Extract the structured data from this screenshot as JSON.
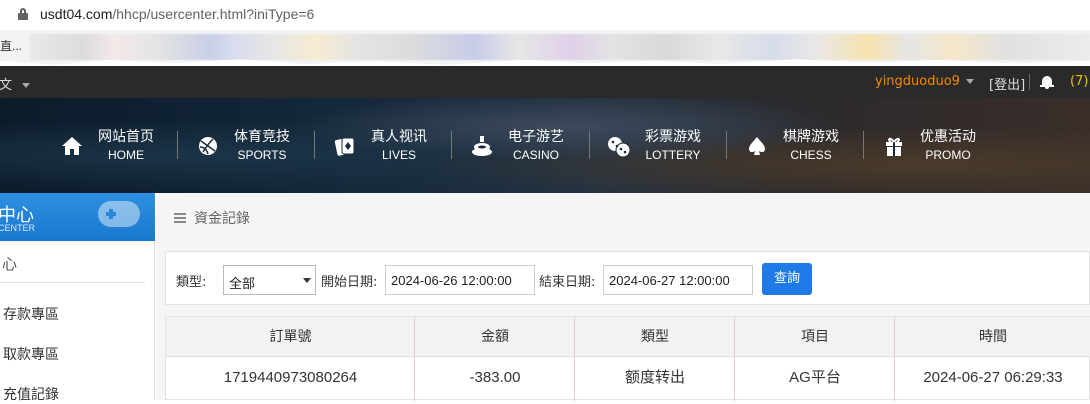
{
  "browser": {
    "url_host": "usdt04.com",
    "url_path": "/hhcp/usercenter.html?iniType=6",
    "bookmark_leading": "直..."
  },
  "topbar": {
    "language": "中文",
    "username": "yingduoduo9",
    "logout": "[登出]",
    "notifications": "(7)"
  },
  "nav": [
    {
      "cn": "网站首页",
      "en": "HOME",
      "icon": "home-icon"
    },
    {
      "cn": "体育竞技",
      "en": "SPORTS",
      "icon": "basketball-icon"
    },
    {
      "cn": "真人视讯",
      "en": "LIVES",
      "icon": "cards-icon"
    },
    {
      "cn": "电子游艺",
      "en": "CASINO",
      "icon": "slot-icon"
    },
    {
      "cn": "彩票游戏",
      "en": "LOTTERY",
      "icon": "dice-icon"
    },
    {
      "cn": "棋牌游戏",
      "en": "CHESS",
      "icon": "spade-icon"
    },
    {
      "cn": "优惠活动",
      "en": "PROMO",
      "icon": "gift-icon"
    }
  ],
  "sidebar": {
    "title_cn": "中心",
    "title_en": "CENTER",
    "sub_title": "心",
    "links": [
      "存款專區",
      "取款專區",
      "充值記錄"
    ]
  },
  "main": {
    "breadcrumb": "資金記錄",
    "filter": {
      "type_label": "類型:",
      "type_value": "全部",
      "start_label": "開始日期:",
      "start_value": "2024-06-26 12:00:00",
      "end_label": "結束日期:",
      "end_value": "2024-06-27 12:00:00",
      "search_button": "查詢"
    },
    "table": {
      "columns": [
        "訂單號",
        "金額",
        "類型",
        "項目",
        "時間"
      ],
      "rows": [
        [
          "1719440973080264",
          "-383.00",
          "额度转出",
          "AG平台",
          "2024-06-27 06:29:33"
        ]
      ]
    }
  },
  "colors": {
    "accent": "#1e7ae6",
    "username": "#f08a00",
    "topbar": "#2a2a2a"
  }
}
